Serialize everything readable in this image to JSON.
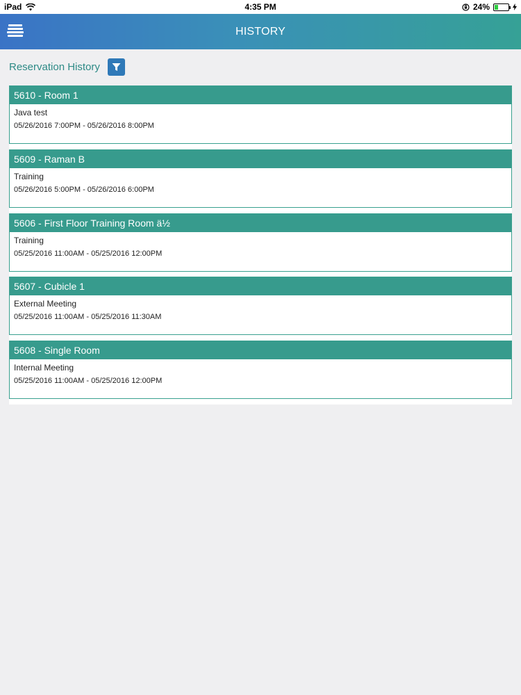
{
  "status_bar": {
    "device": "iPad",
    "time": "4:35 PM",
    "battery": "24%",
    "battery_level": 0.24
  },
  "header": {
    "title": "HISTORY",
    "menu_icon": "hamburger-menu-icon"
  },
  "page": {
    "title": "Reservation History",
    "filter_icon": "filter-icon"
  },
  "reservations": [
    {
      "title": "5610 - Room 1",
      "subject": "Java test",
      "time": "05/26/2016 7:00PM - 05/26/2016 8:00PM"
    },
    {
      "title": "5609 - Raman B",
      "subject": "Training",
      "time": "05/26/2016 5:00PM - 05/26/2016 6:00PM"
    },
    {
      "title": "5606 - First Floor Training Room ä½",
      "subject": "Training",
      "time": "05/25/2016 11:00AM - 05/25/2016 12:00PM"
    },
    {
      "title": "5607 - Cubicle 1",
      "subject": "External Meeting",
      "time": "05/25/2016 11:00AM - 05/25/2016 11:30AM"
    },
    {
      "title": "5608 - Single Room",
      "subject": "Internal Meeting",
      "time": "05/25/2016 11:00AM - 05/25/2016 12:00PM"
    }
  ],
  "colors": {
    "header_start": "#3a73c6",
    "header_end": "#36a196",
    "card_header": "#379b8d",
    "page_title": "#2d8a86",
    "filter_button": "#2f79b8"
  }
}
